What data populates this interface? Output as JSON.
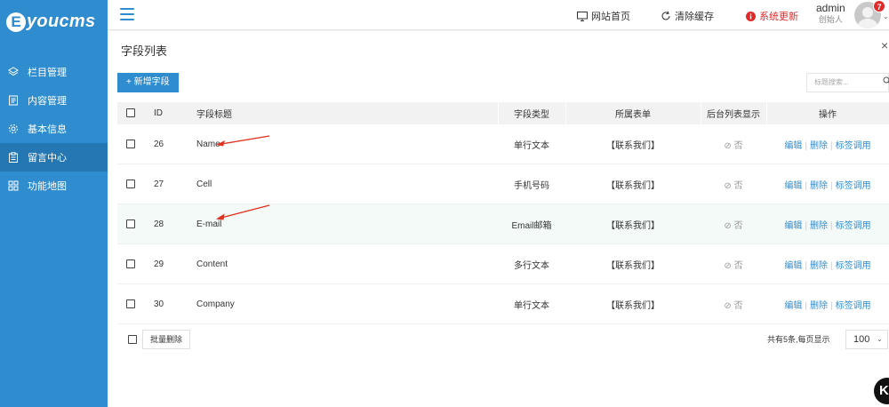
{
  "brand": {
    "initial": "E",
    "name": "youcms"
  },
  "sidebar": {
    "items": [
      {
        "label": "栏目管理",
        "icon": "layers-icon",
        "active": false
      },
      {
        "label": "内容管理",
        "icon": "document-icon",
        "active": false
      },
      {
        "label": "基本信息",
        "icon": "gear-icon",
        "active": false
      },
      {
        "label": "留言中心",
        "icon": "clipboard-icon",
        "active": true
      },
      {
        "label": "功能地图",
        "icon": "grid-icon",
        "active": false
      }
    ]
  },
  "topbar": {
    "site_home": "网站首页",
    "clear_cache": "清除缓存",
    "system_update": "系统更新",
    "user_name": "admin",
    "user_role": "创始人",
    "notification_count": "7"
  },
  "panel": {
    "title": "字段列表",
    "close": "×",
    "add_button": "+ 新增字段",
    "search_placeholder": "标题搜索...",
    "columns": {
      "id": "ID",
      "title": "字段标题",
      "type": "字段类型",
      "form": "所属表单",
      "show": "后台列表显示",
      "ops": "操作"
    },
    "rows": [
      {
        "id": "26",
        "title": "Name",
        "type": "单行文本",
        "form": "【联系我们】",
        "show": "⊘ 否"
      },
      {
        "id": "27",
        "title": "Cell",
        "type": "手机号码",
        "form": "【联系我们】",
        "show": "⊘ 否"
      },
      {
        "id": "28",
        "title": "E-mail",
        "type": "Email邮箱",
        "form": "【联系我们】",
        "show": "⊘ 否"
      },
      {
        "id": "29",
        "title": "Content",
        "type": "多行文本",
        "form": "【联系我们】",
        "show": "⊘ 否"
      },
      {
        "id": "30",
        "title": "Company",
        "type": "单行文本",
        "form": "【联系我们】",
        "show": "⊘ 否"
      }
    ],
    "ops": {
      "edit": "编辑",
      "delete": "删除",
      "tag": "标签调用",
      "sep": "|"
    },
    "bulk_delete": "批量删除",
    "pager_text": "共有5条,每页显示",
    "page_size": "100"
  },
  "colors": {
    "primary": "#2f8ccf",
    "danger": "#e02a2a",
    "annotation_arrow": "#e0301e"
  }
}
